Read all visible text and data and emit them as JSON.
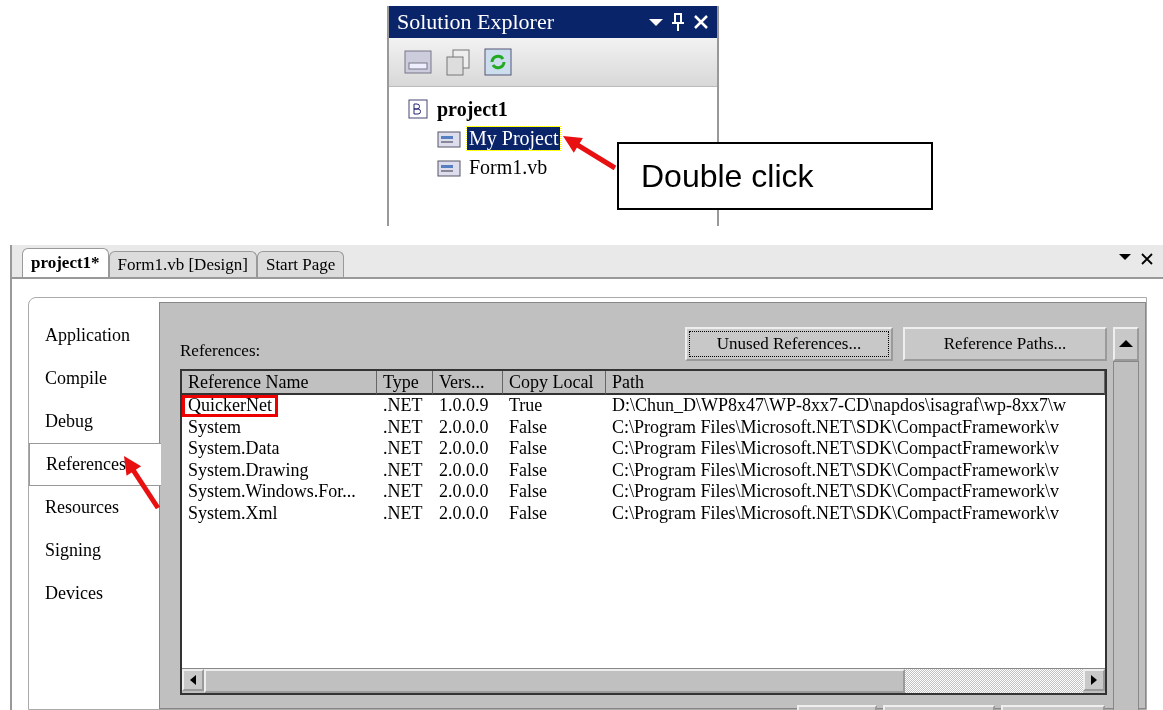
{
  "solution_explorer": {
    "title": "Solution Explorer",
    "tree": [
      {
        "label": "project1",
        "selected": false,
        "children": [
          {
            "label": "My Project",
            "selected": true
          },
          {
            "label": "Form1.vb",
            "selected": false
          }
        ]
      }
    ]
  },
  "callout": {
    "text": "Double click"
  },
  "document_tabs": [
    {
      "label": "project1*",
      "selected": true
    },
    {
      "label": "Form1.vb [Design]",
      "selected": false
    },
    {
      "label": "Start Page",
      "selected": false
    }
  ],
  "nav": [
    {
      "label": "Application",
      "selected": false
    },
    {
      "label": "Compile",
      "selected": false
    },
    {
      "label": "Debug",
      "selected": false
    },
    {
      "label": "References",
      "selected": true
    },
    {
      "label": "Resources",
      "selected": false
    },
    {
      "label": "Signing",
      "selected": false
    },
    {
      "label": "Devices",
      "selected": false
    }
  ],
  "references_label": "References:",
  "buttons": [
    "Unused References...",
    "Reference Paths..."
  ],
  "table": {
    "columns": [
      "Reference Name",
      "Type",
      "Vers...",
      "Copy Local",
      "Path"
    ],
    "rows": [
      {
        "cells": [
          "QuickerNet",
          ".NET",
          "1.0.0.9",
          "True",
          "D:\\Chun_D\\WP8x47\\WP-8xx7-CD\\napdos\\isagraf\\wp-8xx7\\w"
        ],
        "marked": true
      },
      {
        "cells": [
          "System",
          ".NET",
          "2.0.0.0",
          "False",
          "C:\\Program Files\\Microsoft.NET\\SDK\\CompactFramework\\v"
        ],
        "marked": false
      },
      {
        "cells": [
          "System.Data",
          ".NET",
          "2.0.0.0",
          "False",
          "C:\\Program Files\\Microsoft.NET\\SDK\\CompactFramework\\v"
        ],
        "marked": false
      },
      {
        "cells": [
          "System.Drawing",
          ".NET",
          "2.0.0.0",
          "False",
          "C:\\Program Files\\Microsoft.NET\\SDK\\CompactFramework\\v"
        ],
        "marked": false
      },
      {
        "cells": [
          "System.Windows.For...",
          ".NET",
          "2.0.0.0",
          "False",
          "C:\\Program Files\\Microsoft.NET\\SDK\\CompactFramework\\v"
        ],
        "marked": false
      },
      {
        "cells": [
          "System.Xml",
          ".NET",
          "2.0.0.0",
          "False",
          "C:\\Program Files\\Microsoft.NET\\SDK\\CompactFramework\\v"
        ],
        "marked": false
      }
    ]
  }
}
